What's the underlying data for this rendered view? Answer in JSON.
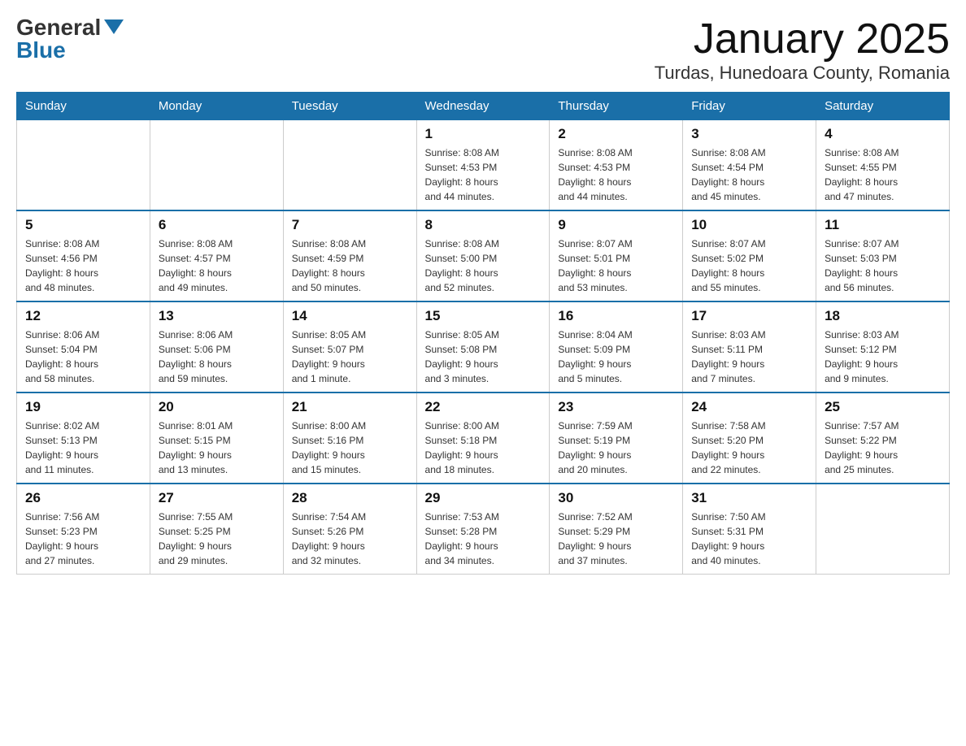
{
  "logo": {
    "general": "General",
    "blue": "Blue"
  },
  "header": {
    "month": "January 2025",
    "location": "Turdas, Hunedoara County, Romania"
  },
  "weekdays": [
    "Sunday",
    "Monday",
    "Tuesday",
    "Wednesday",
    "Thursday",
    "Friday",
    "Saturday"
  ],
  "weeks": [
    [
      {
        "day": "",
        "info": ""
      },
      {
        "day": "",
        "info": ""
      },
      {
        "day": "",
        "info": ""
      },
      {
        "day": "1",
        "info": "Sunrise: 8:08 AM\nSunset: 4:53 PM\nDaylight: 8 hours\nand 44 minutes."
      },
      {
        "day": "2",
        "info": "Sunrise: 8:08 AM\nSunset: 4:53 PM\nDaylight: 8 hours\nand 44 minutes."
      },
      {
        "day": "3",
        "info": "Sunrise: 8:08 AM\nSunset: 4:54 PM\nDaylight: 8 hours\nand 45 minutes."
      },
      {
        "day": "4",
        "info": "Sunrise: 8:08 AM\nSunset: 4:55 PM\nDaylight: 8 hours\nand 47 minutes."
      }
    ],
    [
      {
        "day": "5",
        "info": "Sunrise: 8:08 AM\nSunset: 4:56 PM\nDaylight: 8 hours\nand 48 minutes."
      },
      {
        "day": "6",
        "info": "Sunrise: 8:08 AM\nSunset: 4:57 PM\nDaylight: 8 hours\nand 49 minutes."
      },
      {
        "day": "7",
        "info": "Sunrise: 8:08 AM\nSunset: 4:59 PM\nDaylight: 8 hours\nand 50 minutes."
      },
      {
        "day": "8",
        "info": "Sunrise: 8:08 AM\nSunset: 5:00 PM\nDaylight: 8 hours\nand 52 minutes."
      },
      {
        "day": "9",
        "info": "Sunrise: 8:07 AM\nSunset: 5:01 PM\nDaylight: 8 hours\nand 53 minutes."
      },
      {
        "day": "10",
        "info": "Sunrise: 8:07 AM\nSunset: 5:02 PM\nDaylight: 8 hours\nand 55 minutes."
      },
      {
        "day": "11",
        "info": "Sunrise: 8:07 AM\nSunset: 5:03 PM\nDaylight: 8 hours\nand 56 minutes."
      }
    ],
    [
      {
        "day": "12",
        "info": "Sunrise: 8:06 AM\nSunset: 5:04 PM\nDaylight: 8 hours\nand 58 minutes."
      },
      {
        "day": "13",
        "info": "Sunrise: 8:06 AM\nSunset: 5:06 PM\nDaylight: 8 hours\nand 59 minutes."
      },
      {
        "day": "14",
        "info": "Sunrise: 8:05 AM\nSunset: 5:07 PM\nDaylight: 9 hours\nand 1 minute."
      },
      {
        "day": "15",
        "info": "Sunrise: 8:05 AM\nSunset: 5:08 PM\nDaylight: 9 hours\nand 3 minutes."
      },
      {
        "day": "16",
        "info": "Sunrise: 8:04 AM\nSunset: 5:09 PM\nDaylight: 9 hours\nand 5 minutes."
      },
      {
        "day": "17",
        "info": "Sunrise: 8:03 AM\nSunset: 5:11 PM\nDaylight: 9 hours\nand 7 minutes."
      },
      {
        "day": "18",
        "info": "Sunrise: 8:03 AM\nSunset: 5:12 PM\nDaylight: 9 hours\nand 9 minutes."
      }
    ],
    [
      {
        "day": "19",
        "info": "Sunrise: 8:02 AM\nSunset: 5:13 PM\nDaylight: 9 hours\nand 11 minutes."
      },
      {
        "day": "20",
        "info": "Sunrise: 8:01 AM\nSunset: 5:15 PM\nDaylight: 9 hours\nand 13 minutes."
      },
      {
        "day": "21",
        "info": "Sunrise: 8:00 AM\nSunset: 5:16 PM\nDaylight: 9 hours\nand 15 minutes."
      },
      {
        "day": "22",
        "info": "Sunrise: 8:00 AM\nSunset: 5:18 PM\nDaylight: 9 hours\nand 18 minutes."
      },
      {
        "day": "23",
        "info": "Sunrise: 7:59 AM\nSunset: 5:19 PM\nDaylight: 9 hours\nand 20 minutes."
      },
      {
        "day": "24",
        "info": "Sunrise: 7:58 AM\nSunset: 5:20 PM\nDaylight: 9 hours\nand 22 minutes."
      },
      {
        "day": "25",
        "info": "Sunrise: 7:57 AM\nSunset: 5:22 PM\nDaylight: 9 hours\nand 25 minutes."
      }
    ],
    [
      {
        "day": "26",
        "info": "Sunrise: 7:56 AM\nSunset: 5:23 PM\nDaylight: 9 hours\nand 27 minutes."
      },
      {
        "day": "27",
        "info": "Sunrise: 7:55 AM\nSunset: 5:25 PM\nDaylight: 9 hours\nand 29 minutes."
      },
      {
        "day": "28",
        "info": "Sunrise: 7:54 AM\nSunset: 5:26 PM\nDaylight: 9 hours\nand 32 minutes."
      },
      {
        "day": "29",
        "info": "Sunrise: 7:53 AM\nSunset: 5:28 PM\nDaylight: 9 hours\nand 34 minutes."
      },
      {
        "day": "30",
        "info": "Sunrise: 7:52 AM\nSunset: 5:29 PM\nDaylight: 9 hours\nand 37 minutes."
      },
      {
        "day": "31",
        "info": "Sunrise: 7:50 AM\nSunset: 5:31 PM\nDaylight: 9 hours\nand 40 minutes."
      },
      {
        "day": "",
        "info": ""
      }
    ]
  ]
}
